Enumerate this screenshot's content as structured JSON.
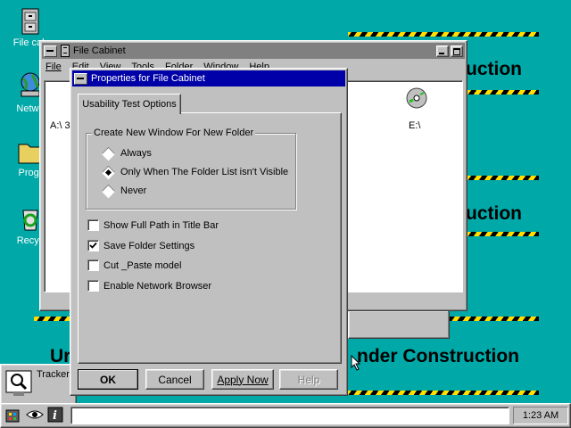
{
  "banner": {
    "line1": "uction",
    "line2": "uction",
    "line3_left": "Ur",
    "line3_right": "nder Construction"
  },
  "desktop_icons": [
    {
      "label": "File cab"
    },
    {
      "label": "Netwo"
    },
    {
      "label": "Progr"
    },
    {
      "label": "Recyc"
    }
  ],
  "file_cabinet": {
    "title": "File Cabinet",
    "menu": [
      "File",
      "Edit",
      "View",
      "Tools",
      "Folder",
      "Window",
      "Help"
    ],
    "drive_a": "A:\\ 3",
    "drive_e": "E:\\"
  },
  "dialog": {
    "title": "Properties for File Cabinet",
    "tab": "Usability Test Options",
    "group_label": "Create New Window For New Folder",
    "radios": [
      {
        "label": "Always",
        "selected": false
      },
      {
        "label": "Only When The Folder List isn't Visible",
        "selected": true
      },
      {
        "label": "Never",
        "selected": false
      }
    ],
    "checkboxes": [
      {
        "label": "Show Full Path in Title Bar",
        "checked": false
      },
      {
        "label": "Save Folder Settings",
        "checked": true
      },
      {
        "label": "Cut _Paste model",
        "checked": false
      },
      {
        "label": "Enable Network Browser",
        "checked": false
      }
    ],
    "buttons": {
      "ok": "OK",
      "cancel": "Cancel",
      "apply": "Apply Now",
      "help": "Help"
    }
  },
  "tracker": {
    "label": "Tracker"
  },
  "taskbar": {
    "clock": "1:23 AM",
    "input_value": ""
  },
  "colors": {
    "desktop": "#00a8a8",
    "title_active": "#0000a8",
    "title_inactive": "#808080",
    "hazard_yellow": "#ffe000"
  }
}
